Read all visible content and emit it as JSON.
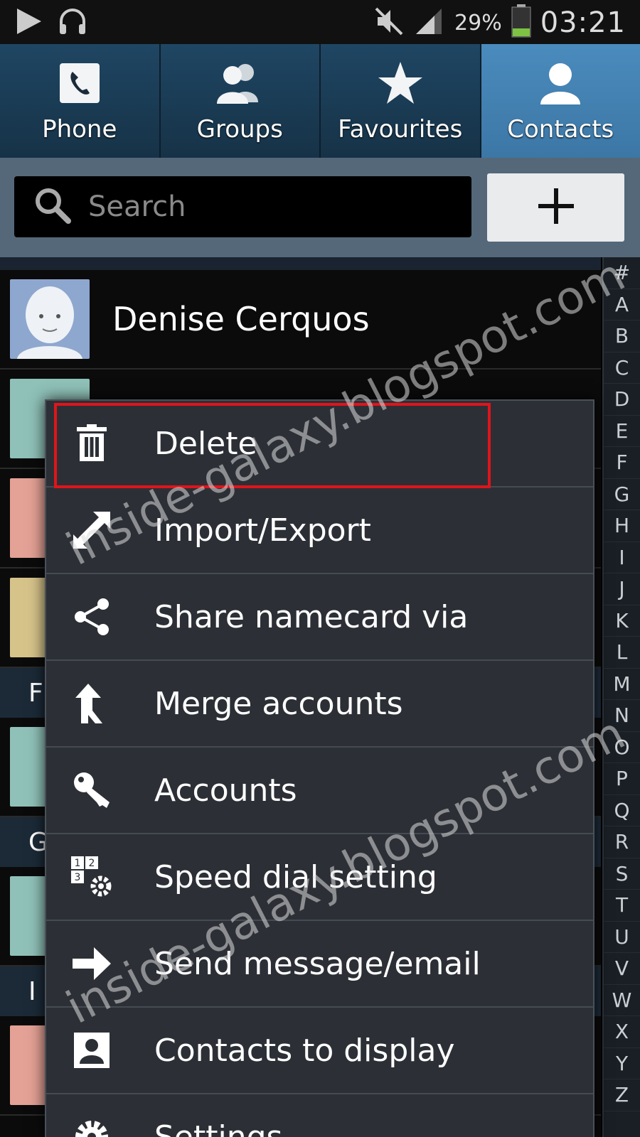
{
  "status_bar": {
    "battery": "29%",
    "time": "03:21"
  },
  "tabs": [
    {
      "label": "Phone",
      "icon": "phone-icon",
      "active": false
    },
    {
      "label": "Groups",
      "icon": "groups-icon",
      "active": false
    },
    {
      "label": "Favourites",
      "icon": "star-icon",
      "active": false
    },
    {
      "label": "Contacts",
      "icon": "contact-icon",
      "active": true
    }
  ],
  "search": {
    "placeholder": "Search",
    "add_label": "+"
  },
  "contacts": {
    "first_name": "Denise Cerquos",
    "section_f": "F",
    "section_g": "G",
    "section_i": "I"
  },
  "index_letters": [
    "#",
    "A",
    "B",
    "C",
    "D",
    "E",
    "F",
    "G",
    "H",
    "I",
    "J",
    "K",
    "L",
    "M",
    "N",
    "O",
    "P",
    "Q",
    "R",
    "S",
    "T",
    "U",
    "V",
    "W",
    "X",
    "Y",
    "Z"
  ],
  "menu": {
    "items": [
      {
        "label": "Delete",
        "icon": "trash-icon"
      },
      {
        "label": "Import/Export",
        "icon": "import-export-icon"
      },
      {
        "label": "Share namecard via",
        "icon": "share-icon"
      },
      {
        "label": "Merge accounts",
        "icon": "merge-icon"
      },
      {
        "label": "Accounts",
        "icon": "key-icon"
      },
      {
        "label": "Speed dial setting",
        "icon": "speed-dial-icon"
      },
      {
        "label": "Send message/email",
        "icon": "arrow-right-icon"
      },
      {
        "label": "Contacts to display",
        "icon": "contact-display-icon"
      },
      {
        "label": "Settings",
        "icon": "gear-icon"
      }
    ]
  },
  "watermark": "inside-galaxy.blogspot.com",
  "colors": {
    "active_tab": "#4a8bbd",
    "highlight": "#e0141b",
    "menu_bg": "#2c3036"
  }
}
